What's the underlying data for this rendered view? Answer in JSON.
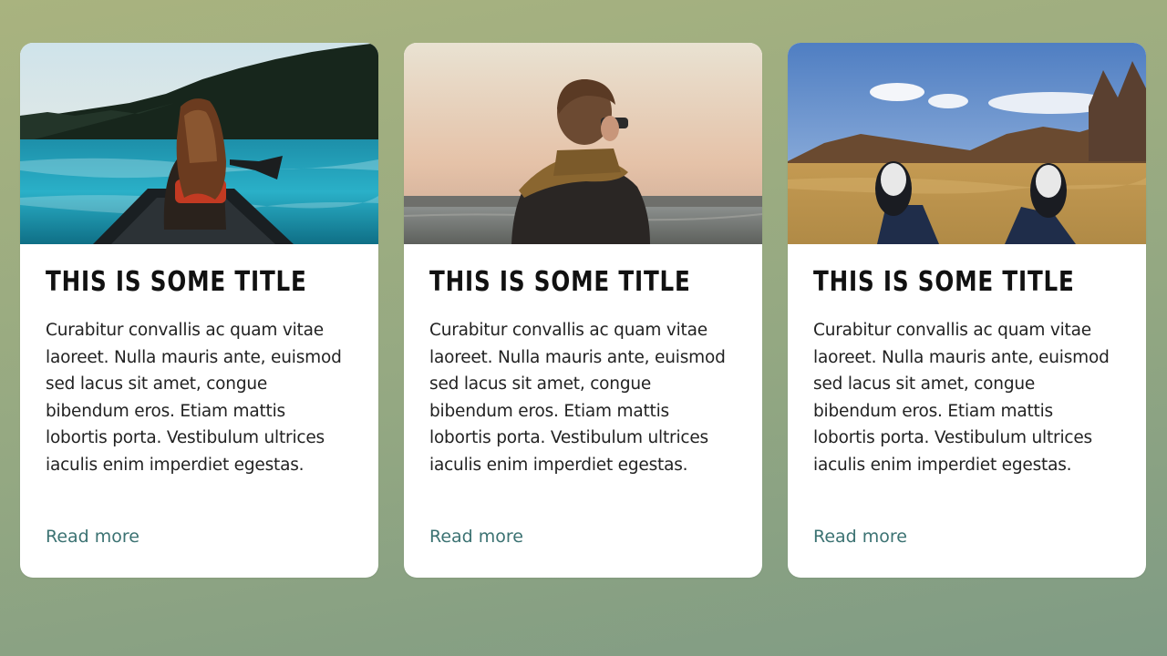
{
  "cards": [
    {
      "image_icon": "canoe-lake-photo",
      "title": "THIS IS SOME TITLE",
      "text": "Curabitur convallis ac quam vitae laoreet. Nulla mauris ante, euismod sed lacus sit amet, congue bibendum eros. Etiam mattis lobortis porta. Vestibulum ultrices iaculis enim imperdiet egestas.",
      "link": "Read more"
    },
    {
      "image_icon": "person-sunset-photo",
      "title": "THIS IS SOME TITLE",
      "text": "Curabitur convallis ac quam vitae laoreet. Nulla mauris ante, euismod sed lacus sit amet, congue bibendum eros. Etiam mattis lobortis porta. Vestibulum ultrices iaculis enim imperdiet egestas.",
      "link": "Read more"
    },
    {
      "image_icon": "sneakers-field-photo",
      "title": "THIS IS SOME TITLE",
      "text": "Curabitur convallis ac quam vitae laoreet. Nulla mauris ante, euismod sed lacus sit amet, congue bibendum eros. Etiam mattis lobortis porta. Vestibulum ultrices iaculis enim imperdiet egestas.",
      "link": "Read more"
    }
  ],
  "colors": {
    "link": "#3b7272",
    "title": "#111111",
    "text": "#222222",
    "card_background": "#ffffff"
  }
}
